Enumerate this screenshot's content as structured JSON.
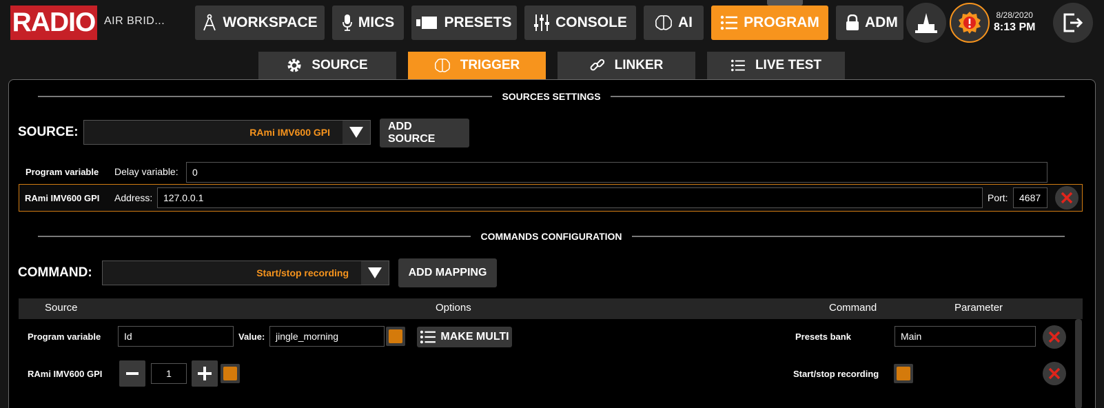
{
  "brand": {
    "logo": "RADIO",
    "station": "AIR BRID..."
  },
  "nav": [
    {
      "label": "WORKSPACE",
      "icon": "compass-icon"
    },
    {
      "label": "MICS",
      "icon": "microphone-icon"
    },
    {
      "label": "PRESETS",
      "icon": "presets-icon"
    },
    {
      "label": "CONSOLE",
      "icon": "sliders-icon"
    },
    {
      "label": "AI",
      "icon": "brain-icon"
    },
    {
      "label": "PROGRAM",
      "icon": "list-icon",
      "active": true
    },
    {
      "label": "ADM",
      "icon": "lock-icon"
    }
  ],
  "clock": {
    "date": "8/28/2020",
    "time": "8:13 PM"
  },
  "subtabs": [
    {
      "label": "SOURCE",
      "icon": "gear-icon"
    },
    {
      "label": "TRIGGER",
      "icon": "brain-icon",
      "active": true
    },
    {
      "label": "LINKER",
      "icon": "link-icon"
    },
    {
      "label": "LIVE TEST",
      "icon": "list-icon"
    }
  ],
  "sources": {
    "title": "SOURCES SETTINGS",
    "source_label": "SOURCE:",
    "source_value": "RAmi IMV600 GPI",
    "add_source": "ADD SOURCE",
    "rows": [
      {
        "name": "Program variable",
        "field_label": "Delay variable:",
        "field_value": "0"
      },
      {
        "name": "RAmi IMV600 GPI",
        "field_label": "Address:",
        "field_value": "127.0.0.1",
        "port_label": "Port:",
        "port_value": "4687"
      }
    ]
  },
  "commands": {
    "title": "COMMANDS CONFIGURATION",
    "command_label": "COMMAND:",
    "command_value": "Start/stop recording",
    "add_mapping": "ADD MAPPING",
    "columns": [
      "Source",
      "Options",
      "Command",
      "Parameter"
    ],
    "rows": [
      {
        "source": "Program variable",
        "id_value": "Id",
        "value_label": "Value:",
        "value": "jingle_morning",
        "multi": "MAKE MULTI",
        "command": "Presets bank",
        "parameter": "Main"
      },
      {
        "source": "RAmi IMV600 GPI",
        "counter": "1",
        "command": "Start/stop recording"
      }
    ]
  },
  "colors": {
    "accent": "#f7941d",
    "brand": "#c62027",
    "delete": "#e0241b"
  }
}
